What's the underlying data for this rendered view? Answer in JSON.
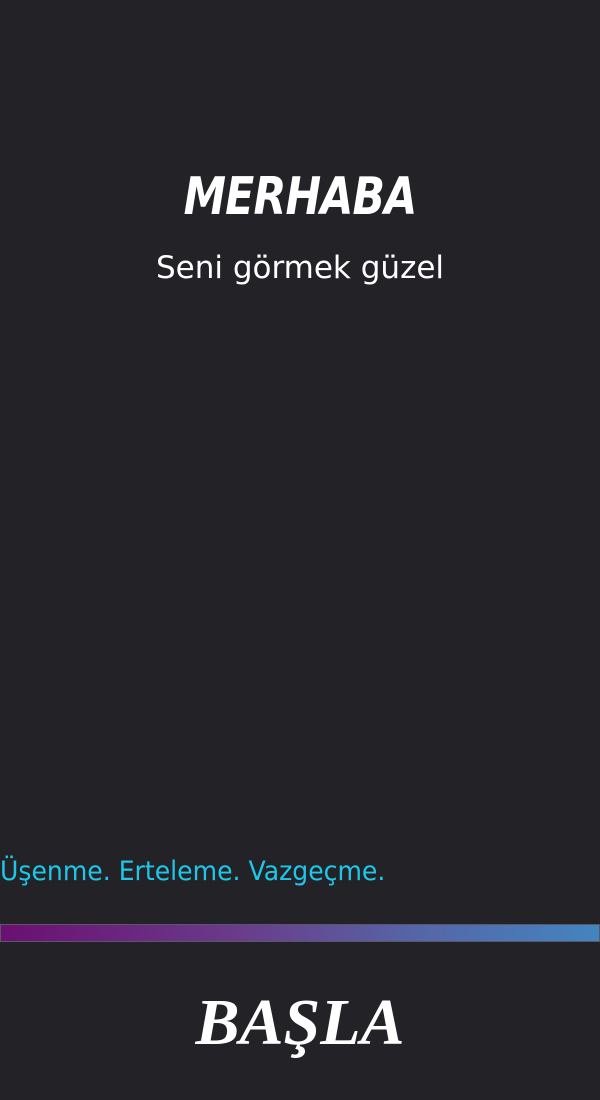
{
  "greeting": {
    "title": "MERHABA",
    "subtitle": "Seni görmek güzel"
  },
  "motto": "Üşenme. Erteleme. Vazgeçme.",
  "start_button": {
    "label": "BAŞLA"
  },
  "colors": {
    "background": "#232227",
    "text": "#ffffff",
    "accent": "#1ec7ea",
    "gradient_start": "#6b0f73",
    "gradient_end": "#4285c1"
  }
}
